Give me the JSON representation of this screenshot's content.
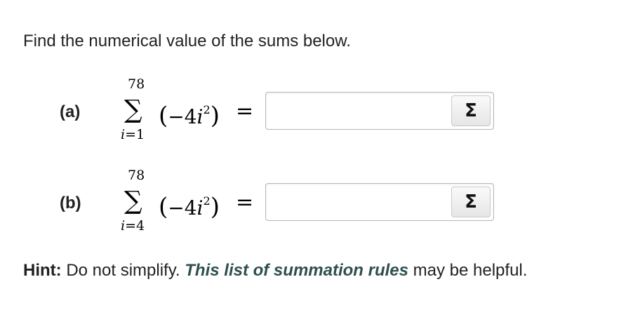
{
  "prompt": "Find the numerical value of the sums below.",
  "parts": [
    {
      "label": "(a)",
      "upper_limit": "78",
      "sigma": "∑",
      "lower_var": "i",
      "lower_eq": "=",
      "lower_start": "1",
      "summand_open": "(",
      "summand_coef": "−4",
      "summand_var": "i",
      "summand_exp": "2",
      "summand_close": ")",
      "equals": "=",
      "input_value": "",
      "button_glyph": "Σ",
      "button_icon": "sigma-icon"
    },
    {
      "label": "(b)",
      "upper_limit": "78",
      "sigma": "∑",
      "lower_var": "i",
      "lower_eq": "=",
      "lower_start": "4",
      "summand_open": "(",
      "summand_coef": "−4",
      "summand_var": "i",
      "summand_exp": "2",
      "summand_close": ")",
      "equals": "=",
      "input_value": "",
      "button_glyph": "Σ",
      "button_icon": "sigma-icon"
    }
  ],
  "hint": {
    "label": "Hint:",
    "text_before": " Do not simplify. ",
    "link_text": "This list of summation rules",
    "text_after": " may be helpful.",
    "link_color": "#2f4f4f"
  }
}
